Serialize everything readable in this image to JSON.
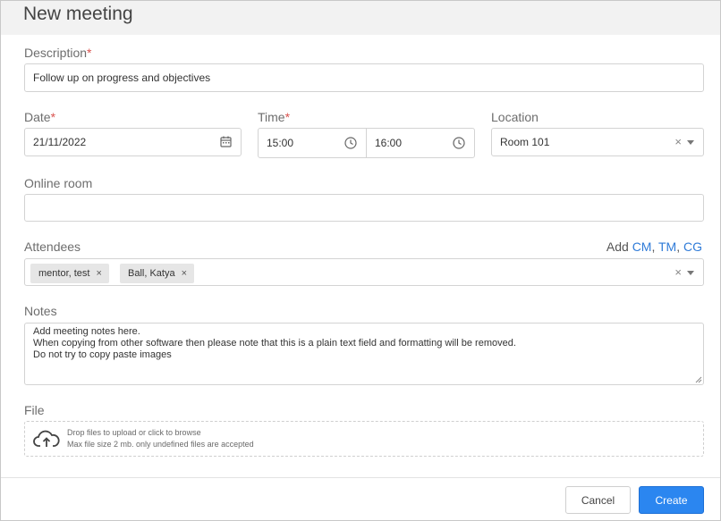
{
  "dialog": {
    "title": "New meeting"
  },
  "description": {
    "label": "Description",
    "required_mark": "*",
    "value": "Follow up on progress and objectives"
  },
  "date": {
    "label": "Date",
    "required_mark": "*",
    "value": "21/11/2022",
    "icon": "calendar-icon"
  },
  "time": {
    "label": "Time",
    "required_mark": "*",
    "start": "15:00",
    "end": "16:00",
    "icon": "clock-icon"
  },
  "location": {
    "label": "Location",
    "value": "Room 101",
    "clear": "×"
  },
  "online_room": {
    "label": "Online room",
    "value": ""
  },
  "attendees": {
    "label": "Attendees",
    "add_prefix": "Add",
    "add_links": [
      "CM",
      "TM",
      "CG"
    ],
    "separator": ",",
    "chips": [
      "mentor, test",
      "Ball, Katya"
    ],
    "chip_remove": "×",
    "clear": "×"
  },
  "notes": {
    "label": "Notes",
    "value": "Add meeting notes here.\nWhen copying from other software then please note that this is a plain text field and formatting will be removed.\nDo not try to copy paste images"
  },
  "file": {
    "label": "File",
    "drop_text": "Drop files to upload or click to browse",
    "limit_text": "Max file size 2 mb. only undefined files are accepted",
    "icon": "cloud-upload-icon"
  },
  "footer": {
    "cancel_label": "Cancel",
    "create_label": "Create"
  },
  "colors": {
    "link": "#2f7bd8",
    "primary": "#2b86f0",
    "required": "#d9534f",
    "header_bg": "#f2f2f2"
  }
}
